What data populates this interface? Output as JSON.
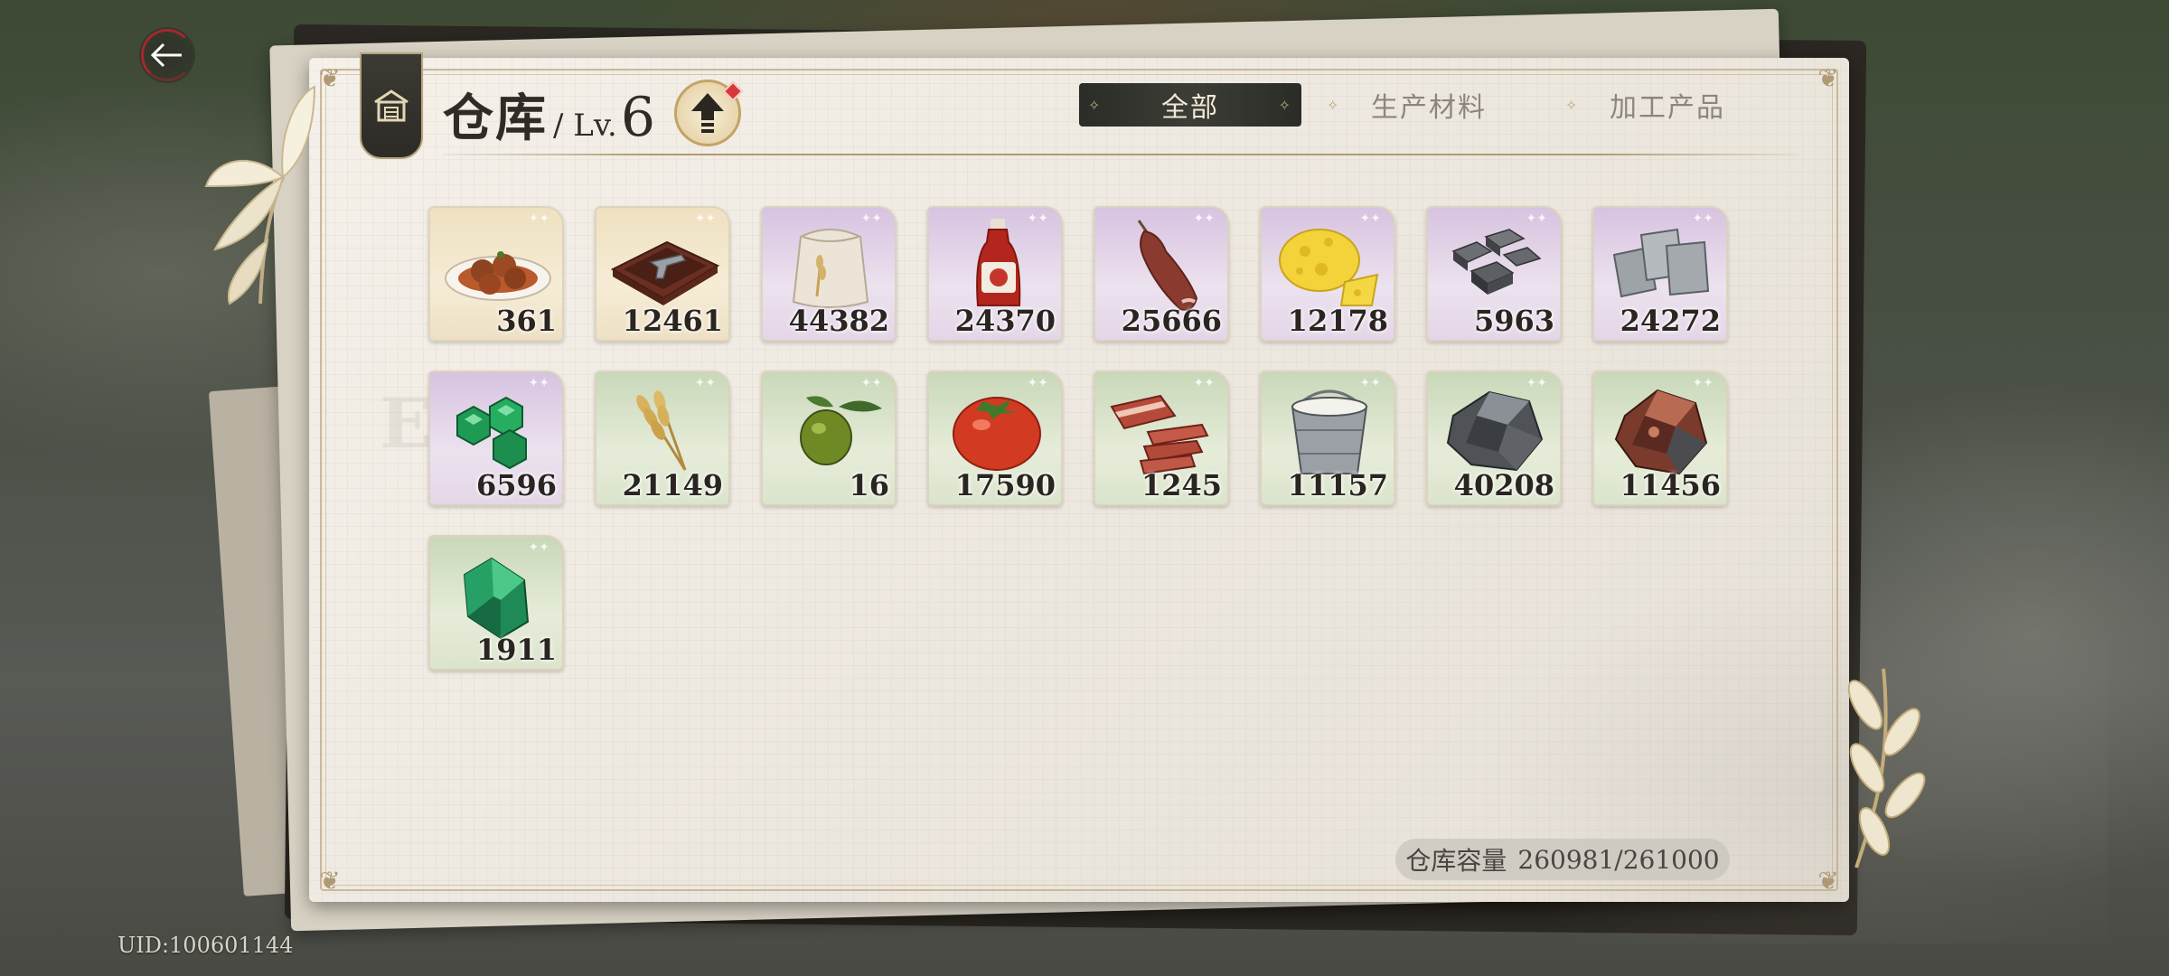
{
  "header": {
    "title": "仓库",
    "level_prefix": "/ Lv.",
    "level": "6"
  },
  "tabs": [
    {
      "label": "全部",
      "active": true
    },
    {
      "label": "生产材料",
      "active": false
    },
    {
      "label": "加工产品",
      "active": false
    }
  ],
  "items": [
    {
      "icon": "meatballs-plate-icon",
      "qty": "361",
      "rarity": "gold"
    },
    {
      "icon": "pistol-case-icon",
      "qty": "12461",
      "rarity": "gold"
    },
    {
      "icon": "flour-sack-icon",
      "qty": "44382",
      "rarity": "purple"
    },
    {
      "icon": "ketchup-bottle-icon",
      "qty": "24370",
      "rarity": "purple"
    },
    {
      "icon": "ham-leg-icon",
      "qty": "25666",
      "rarity": "purple"
    },
    {
      "icon": "cheese-icon",
      "qty": "12178",
      "rarity": "purple"
    },
    {
      "icon": "iron-ingots-icon",
      "qty": "5963",
      "rarity": "purple"
    },
    {
      "icon": "steel-plates-icon",
      "qty": "24272",
      "rarity": "purple"
    },
    {
      "icon": "emerald-gems-icon",
      "qty": "6596",
      "rarity": "purple"
    },
    {
      "icon": "wheat-icon",
      "qty": "21149",
      "rarity": "green"
    },
    {
      "icon": "olive-icon",
      "qty": "16",
      "rarity": "green"
    },
    {
      "icon": "tomato-icon",
      "qty": "17590",
      "rarity": "green"
    },
    {
      "icon": "bacon-icon",
      "qty": "1245",
      "rarity": "green"
    },
    {
      "icon": "milk-bucket-icon",
      "qty": "11157",
      "rarity": "green"
    },
    {
      "icon": "iron-ore-icon",
      "qty": "40208",
      "rarity": "green"
    },
    {
      "icon": "copper-ore-icon",
      "qty": "11456",
      "rarity": "green"
    },
    {
      "icon": "green-crystal-icon",
      "qty": "1911",
      "rarity": "green"
    }
  ],
  "capacity": {
    "label": "仓库容量",
    "value": "260981/261000"
  },
  "uid": "UID:100601144",
  "colors": {
    "tab_active_bg": "#2b2c27",
    "panel_bg": "#f5f1ea",
    "accent_gold": "#b09a74",
    "notification_red": "#d8383a"
  }
}
